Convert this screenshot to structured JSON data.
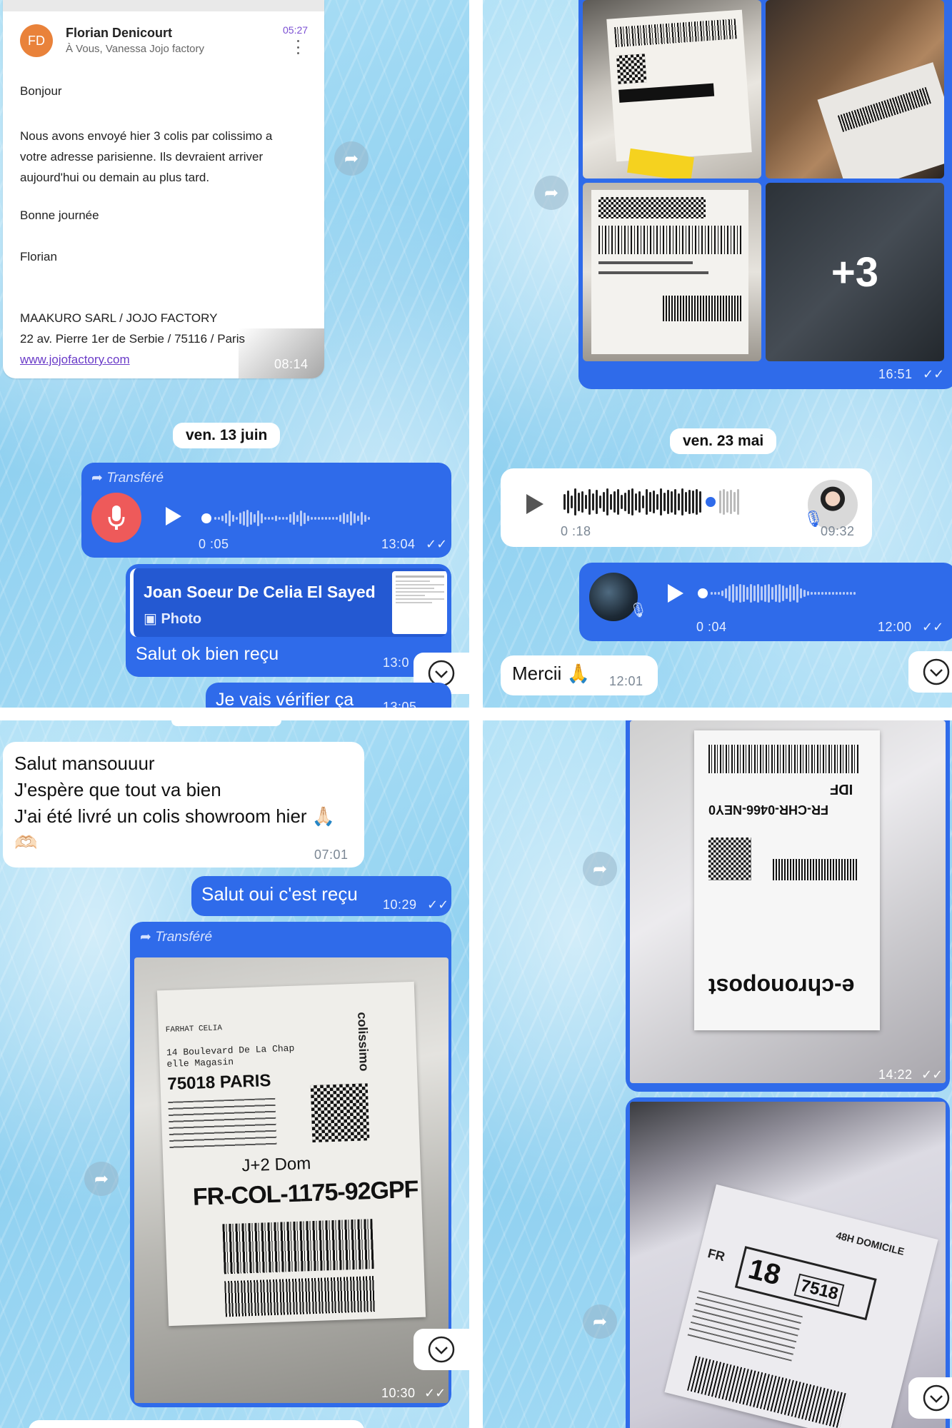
{
  "q1": {
    "email": {
      "avatar": "FD",
      "sender": "Florian Denicourt",
      "recipients": "À Vous, Vanessa Jojo factory",
      "time_top": "05:27",
      "greeting": "Bonjour",
      "body_lines": [
        "Nous avons envoyé hier 3 colis par colissimo a",
        "votre adresse parisienne. Ils devraient arriver",
        "aujourd'hui ou demain au plus tard."
      ],
      "closing": "Bonne journée",
      "signature": "Florian",
      "company": "MAAKURO SARL / JOJO FACTORY",
      "address": "22 av. Pierre 1er de Serbie / 75116 / Paris",
      "link": "www.jojofactory.com",
      "time": "08:14"
    },
    "date": "ven. 13 juin",
    "voice": {
      "forwarded": "Transféré",
      "duration": "0 :05",
      "time": "13:04"
    },
    "reply": {
      "author": "Joan Soeur De Celia El Sayed",
      "kind": "Photo",
      "text": "Salut ok bien reçu",
      "time": "13:0"
    },
    "next_text": "Je vais vérifier ça",
    "next_time": "13:05"
  },
  "q2": {
    "album": {
      "more": "+3",
      "time": "16:51"
    },
    "date": "ven. 23 mai",
    "voice_in": {
      "duration": "0 :18",
      "time": "09:32"
    },
    "voice_out": {
      "duration": "0 :04",
      "time": "12:00"
    },
    "msg": {
      "text": "Mercii 🙏",
      "time": "12:01"
    }
  },
  "q3": {
    "msg_in": {
      "lines": [
        "Salut mansouuur",
        "J'espère que tout va bien",
        "J'ai été livré un colis showroom hier 🙏🏻",
        "🫶🏻"
      ],
      "time": "07:01"
    },
    "msg_out": {
      "text": "Salut oui c'est reçu",
      "time": "10:29"
    },
    "fwd_photo": {
      "forwarded": "Transféré",
      "time": "10:30"
    },
    "label": {
      "name": "FARHAT CELIA",
      "addr1": "14 Boulevard De La Chap",
      "addr2": "elle Magasin",
      "city": "75018 PARIS",
      "service": "J+2 Dom",
      "tracking": "FR-COL-1175-92GPF",
      "brand": "colissimo"
    }
  },
  "q4": {
    "photo1": {
      "brand": "e-chronopost",
      "ref": "FR-CHR-0466-NEY0",
      "code": "IDF",
      "time": "14:22"
    },
    "photo2": {
      "service": "48H DOMICILE",
      "num": "18",
      "zip": "7518",
      "country": "FR"
    }
  },
  "colors": {
    "accent": "#2f6bea",
    "bg": "#9fd8f3",
    "mic": "#ee5a5a"
  }
}
